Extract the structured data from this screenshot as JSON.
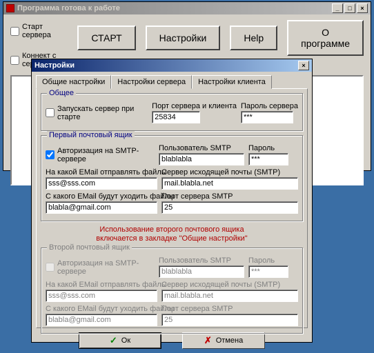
{
  "mainWindow": {
    "title": "Программа готова к работе",
    "checks": {
      "startServer": "Старт сервера",
      "connectServer": "Коннект с сервером"
    },
    "buttons": {
      "start": "СТАРТ",
      "settings": "Настройки",
      "help": "Help",
      "about": "О программе"
    }
  },
  "modal": {
    "title": "Настройки",
    "tabs": {
      "general": "Общие настройки",
      "server": "Настройки сервера",
      "client": "Настройки клиента"
    },
    "general_group": {
      "title": "Общее",
      "autostart": "Запускать сервер при старте",
      "port_label": "Порт сервера и клиента",
      "port_value": "25834",
      "pass_label": "Пароль сервера",
      "pass_value": "***"
    },
    "mailbox1": {
      "title": "Первый почтовый ящик",
      "smtp_auth": "Авторизация на SMTP-сервере",
      "user_label": "Пользователь SMTP",
      "user_value": "blablabla",
      "pass_label": "Пароль",
      "pass_value": "***",
      "sendto_label": "На какой EMail отправлять файлы",
      "sendto_value": "sss@sss.com",
      "smtp_label": "Сервер исходящей почты (SMTP)",
      "smtp_value": "mail.blabla.net",
      "from_label": "С какого EMail будут уходить файлы",
      "from_value": "blabla@gmail.com",
      "port_label": "Порт сервера SMTP",
      "port_value": "25"
    },
    "note_line1": "Использование второго почтового ящика",
    "note_line2": "включается  в закладке \"Общие настройки\"",
    "mailbox2": {
      "title": "Второй почтовый ящик",
      "smtp_auth": "Авторизация на SMTP-сервере",
      "user_label": "Пользователь SMTP",
      "user_value": "blablabla",
      "pass_label": "Пароль",
      "pass_value": "***",
      "sendto_label": "На какой EMail отправлять файлы",
      "sendto_value": "sss@sss.com",
      "smtp_label": "Сервер исходящей почты (SMTP)",
      "smtp_value": "mail.blabla.net",
      "from_label": "С какого EMail будут уходить файлы",
      "from_value": "blabla@gmail.com",
      "port_label": "Порт сервера SMTP",
      "port_value": "25"
    },
    "buttons": {
      "ok": "Ок",
      "cancel": "Отмена"
    }
  }
}
